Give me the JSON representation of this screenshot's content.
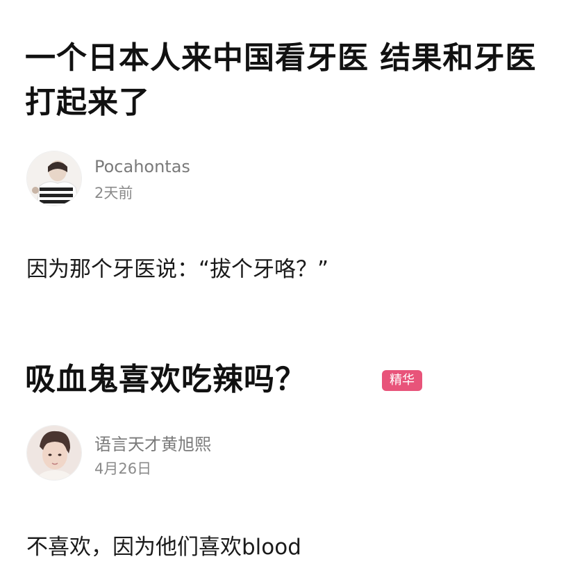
{
  "posts": [
    {
      "title": "一个日本人来中国看牙医 结果和牙医打起来了",
      "author": "Pocahontas",
      "date": "2天前",
      "body": "因为那个牙医说：“拔个牙咯？”"
    },
    {
      "title": "吸血鬼喜欢吃辣吗？",
      "badge": "精华",
      "author": "语言天才黄旭熙",
      "date": "4月26日",
      "body": "不喜欢，因为他们喜欢blood"
    }
  ],
  "colors": {
    "badge_bg": "#e8547a",
    "meta_text": "#7a7a7a",
    "title_text": "#111111"
  }
}
